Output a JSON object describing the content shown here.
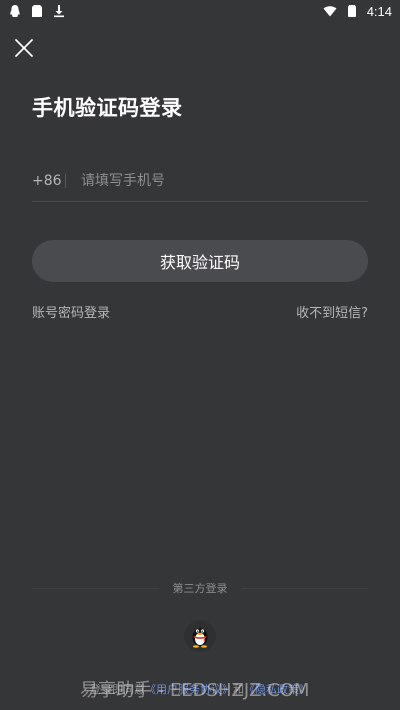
{
  "status_bar": {
    "time": "4:14",
    "icons": [
      "qq-notification-icon",
      "sim-card-icon",
      "download-icon",
      "wifi-icon",
      "battery-icon"
    ]
  },
  "header": {
    "close_icon": "close-icon",
    "title": "手机验证码登录"
  },
  "phone": {
    "country_code": "+86",
    "placeholder": "请填写手机号",
    "value": ""
  },
  "actions": {
    "get_code_label": "获取验证码",
    "password_login_label": "账号密码登录",
    "no_sms_label": "收不到短信?"
  },
  "third_party": {
    "label": "第三方登录",
    "qq_icon": "qq-penguin-icon"
  },
  "footer": {
    "prefix": "登录即同意",
    "terms_link": "《用户服务协议》",
    "connector": "和",
    "privacy_link": "《隐私政策》"
  },
  "watermark": {
    "text": "易享助手 - EEDSHZJZ.COM"
  },
  "colors": {
    "background": "#353638",
    "button": "#4a4b4e",
    "muted_text": "#b5b6b8",
    "link": "#6e8fd6"
  }
}
